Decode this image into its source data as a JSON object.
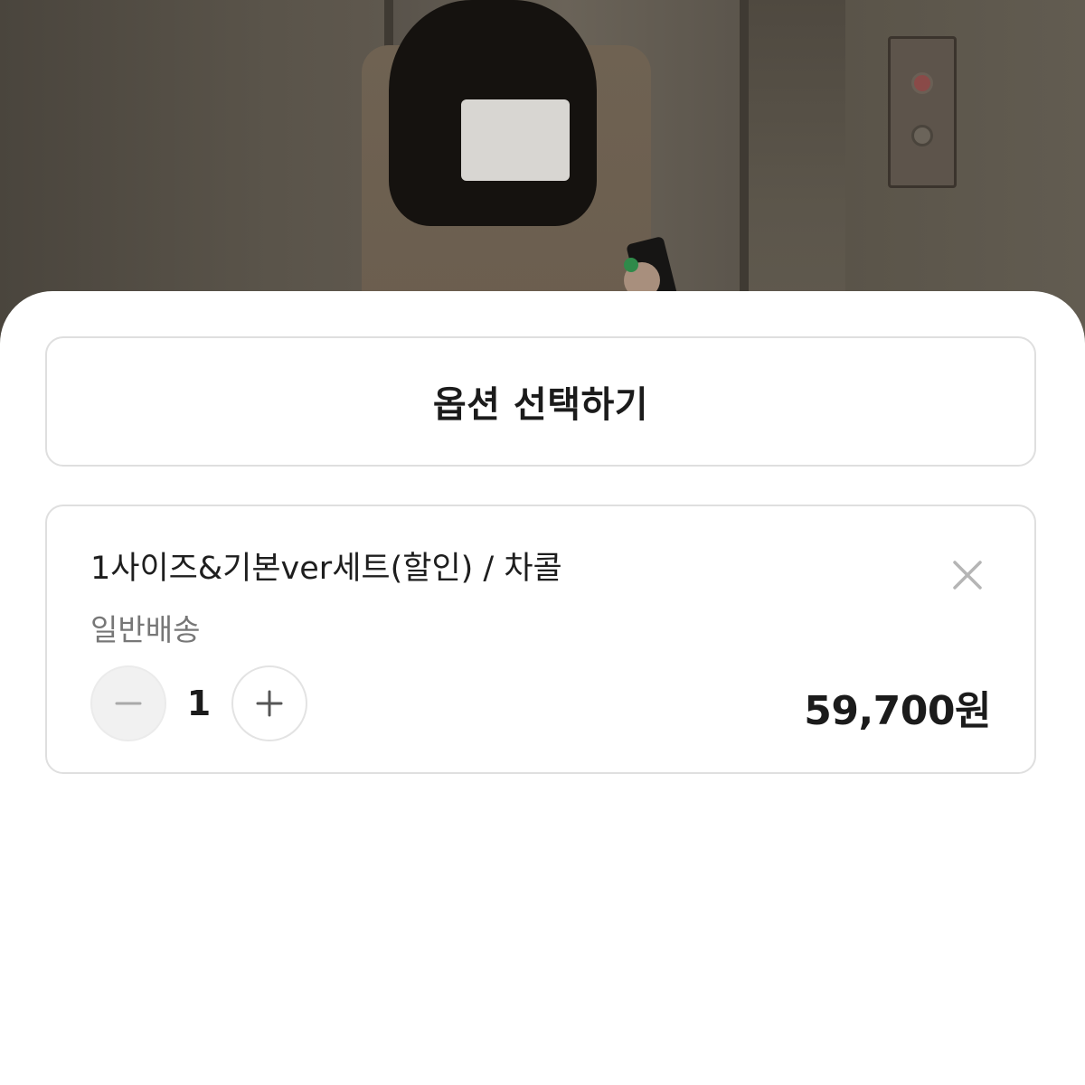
{
  "option_selector": {
    "label": "옵션 선택하기"
  },
  "selected_item": {
    "name": "1사이즈&기본ver세트(할인) / 차콜",
    "shipping": "일반배송",
    "quantity": "1",
    "price": "59,700원",
    "remove_icon": "close-icon",
    "decrement_icon": "minus-icon",
    "increment_icon": "plus-icon"
  },
  "colors": {
    "border": "#dfdfdf",
    "text": "#1b1b1b",
    "muted_text": "#777777"
  }
}
